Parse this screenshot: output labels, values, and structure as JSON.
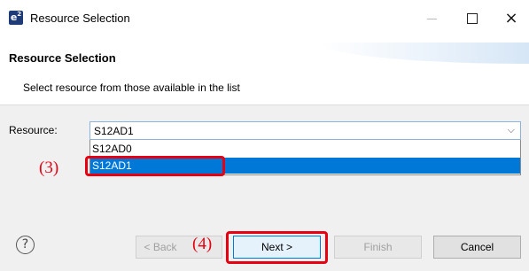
{
  "window": {
    "title": "Resource Selection",
    "icon_text": "e",
    "icon_sup": "2",
    "close_glyph": "×"
  },
  "banner": {
    "title": "Resource Selection",
    "description": "Select resource from those available in the list"
  },
  "resource": {
    "label": "Resource:",
    "selected": "S12AD1",
    "arrow_glyph": "⌵",
    "options": [
      "S12AD0",
      "S12AD1"
    ]
  },
  "annotations": {
    "step3": "(3)",
    "step4": "(4)"
  },
  "footer": {
    "help_glyph": "?",
    "back_label": "< Back",
    "next_label": "Next >",
    "finish_label": "Finish",
    "cancel_label": "Cancel"
  },
  "colors": {
    "selection": "#0078d7",
    "annotation": "#e60012",
    "icon": "#1f3b78"
  },
  "icons": [
    "app-icon",
    "minimize-icon",
    "maximize-icon",
    "close-icon",
    "dropdown-arrow-icon",
    "help-icon"
  ]
}
